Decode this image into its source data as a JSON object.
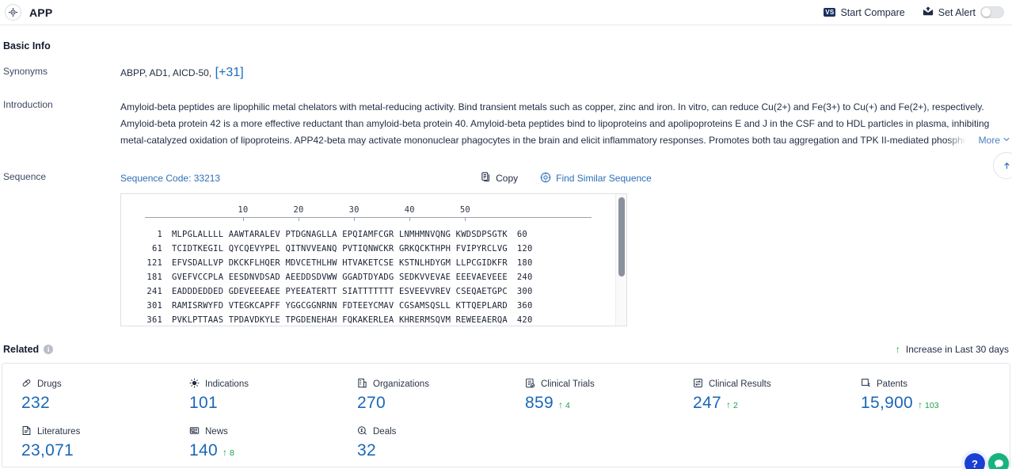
{
  "topbar": {
    "entity_icon": "target-icon",
    "title": "APP",
    "start_compare": {
      "label": "Start Compare",
      "icon": "vs-badge-icon",
      "badge_text": "VS"
    },
    "set_alert": {
      "label": "Set Alert",
      "icon": "alert-mail-icon",
      "toggle_state": "off"
    }
  },
  "basic_info": {
    "heading": "Basic Info",
    "synonyms": {
      "label": "Synonyms",
      "values": "ABPP,  AD1,  AICD-50,",
      "more_label": "[+31]"
    },
    "introduction": {
      "label": "Introduction",
      "text": "Amyloid-beta peptides are lipophilic metal chelators with metal-reducing activity. Bind transient metals such as copper, zinc and iron. In vitro, can reduce Cu(2+) and Fe(3+) to Cu(+) and Fe(2+), respectively. Amyloid-beta protein 42 is a more effective reductant than amyloid-beta protein 40. Amyloid-beta peptides bind to lipoproteins and apolipoproteins E and J in the CSF and to HDL particles in plasma, inhibiting metal-catalyzed oxidation of lipoproteins. APP42-beta may activate mononuclear phagocytes in the brain and elicit inflammatory responses. Promotes both tau aggregation and TPK II-mediated phosphorylation. Interaction with overexpressed H",
      "more_label": "More",
      "more_icon": "chevron-expand-icon"
    },
    "sequence": {
      "label": "Sequence",
      "code_label": "Sequence Code: 33213",
      "copy_label": "Copy",
      "copy_icon": "copy-icon",
      "find_similar_label": "Find Similar Sequence",
      "find_similar_icon": "similar-sequence-icon",
      "ruler_ticks": [
        10,
        20,
        30,
        40,
        50
      ],
      "rows": [
        {
          "start": "1",
          "chunks": "MLPGLALLLL AAWTARALEV PTDGNAGLLA EPQIAMFCGR LNMHMNVQNG KWDSDPSGTK",
          "end": "60"
        },
        {
          "start": "61",
          "chunks": "TCIDTKEGIL QYCQEVYPEL QITNVVEANQ PVTIQNWCKR GRKQCKTHPH FVIPYRCLVG",
          "end": "120"
        },
        {
          "start": "121",
          "chunks": "EFVSDALLVP DKCKFLHQER MDVCETHLHW HTVAKETCSE KSTNLHDYGM LLPCGIDKFR",
          "end": "180"
        },
        {
          "start": "181",
          "chunks": "GVEFVCCPLA EESDNVDSAD AEEDDSDVWW GGADTDYADG SEDKVVEVAE EEEVAEVEEE",
          "end": "240"
        },
        {
          "start": "241",
          "chunks": "EADDDEDDED GDEVEEEAEE PYEEATERTT SIATTTTTTT ESVEEVVREV CSEQAETGPC",
          "end": "300"
        },
        {
          "start": "301",
          "chunks": "RAMISRWYFD VTEGKCAPFF YGGCGGNRNN FDTEEYCMAV CGSAMSQSLL KTTQEPLARD",
          "end": "360"
        },
        {
          "start": "361",
          "chunks": "PVKLPTTAAS TPDAVDKYLE TPGDENEHAH FQKAKERLEA KHRERMSQVM REWEEAERQA",
          "end": "420"
        }
      ]
    }
  },
  "related": {
    "title": "Related",
    "info_icon": "info-icon",
    "legend": {
      "icon": "arrow-up-icon",
      "label": "Increase in Last 30 days"
    },
    "stats": [
      {
        "label": "Drugs",
        "icon": "capsule-icon",
        "value": "232",
        "delta": null
      },
      {
        "label": "Indications",
        "icon": "virus-icon",
        "value": "101",
        "delta": null
      },
      {
        "label": "Organizations",
        "icon": "building-icon",
        "value": "270",
        "delta": null
      },
      {
        "label": "Clinical Trials",
        "icon": "clinical-trial-icon",
        "value": "859",
        "delta": "4"
      },
      {
        "label": "Clinical Results",
        "icon": "clinical-result-icon",
        "value": "247",
        "delta": "2"
      },
      {
        "label": "Patents",
        "icon": "patent-icon",
        "value": "15,900",
        "delta": "103"
      },
      {
        "label": "Literatures",
        "icon": "literature-icon",
        "value": "23,071",
        "delta": null
      },
      {
        "label": "News",
        "icon": "news-icon",
        "value": "140",
        "delta": "8"
      },
      {
        "label": "Deals",
        "icon": "deals-icon",
        "value": "32",
        "delta": null
      }
    ]
  },
  "floating": {
    "help_label": "?",
    "help_icon": "help-fab-icon",
    "chat_icon": "chat-fab-icon"
  },
  "colors": {
    "accent_blue": "#1b67b8",
    "link_blue": "#2f6fb5",
    "increase_green": "#17a04a",
    "text_dark": "#1f2b43"
  }
}
